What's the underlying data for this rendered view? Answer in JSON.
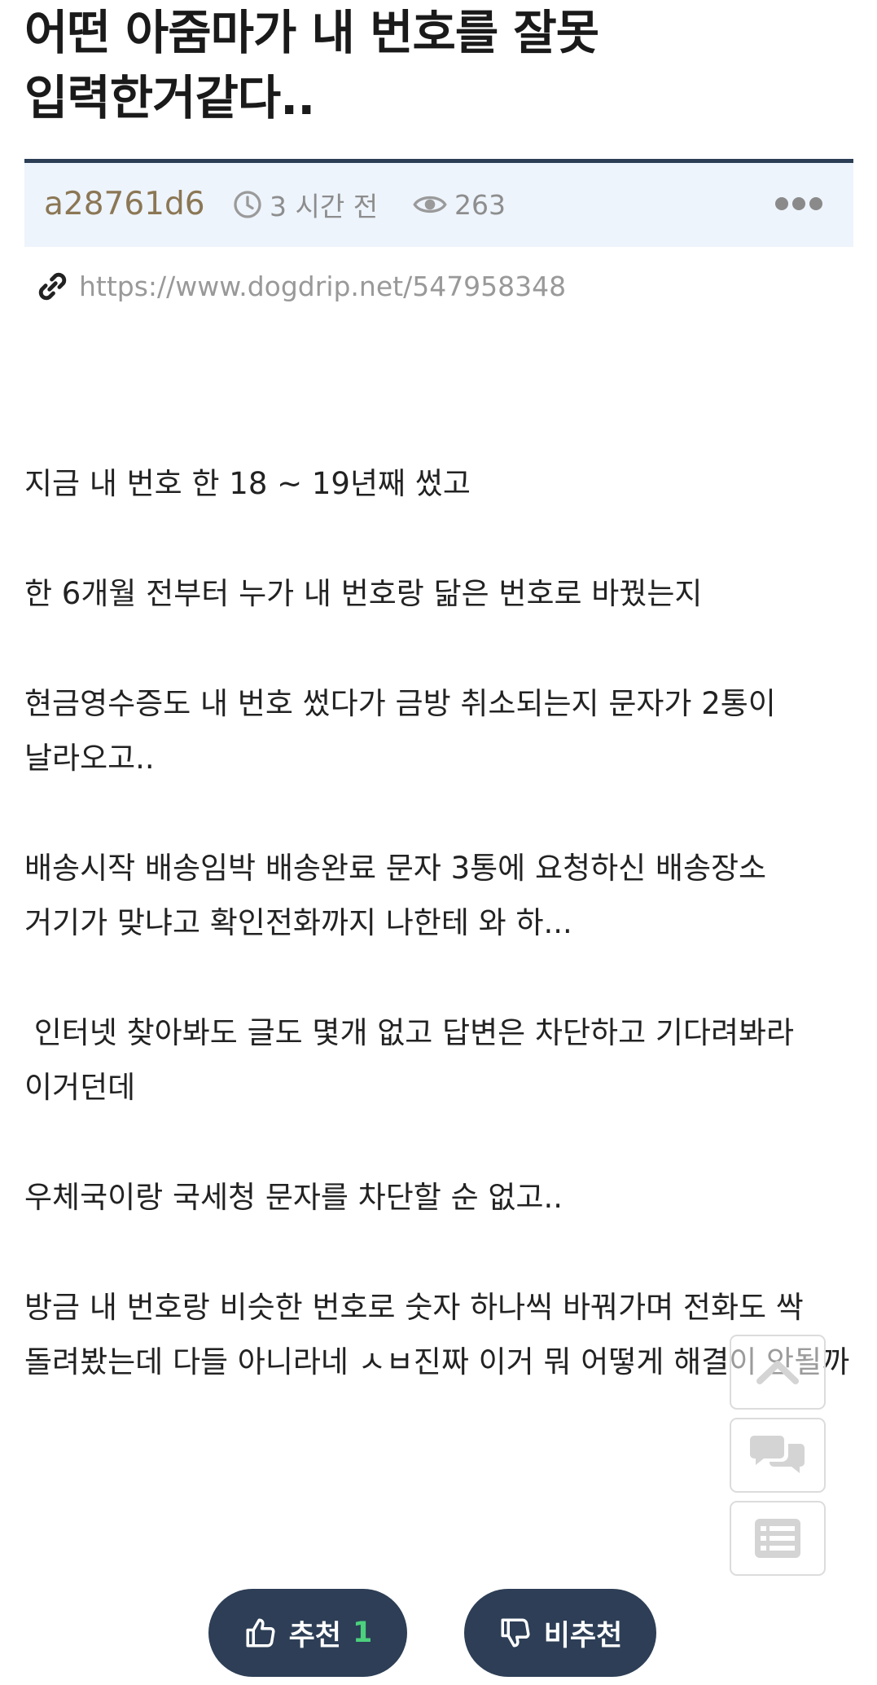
{
  "post": {
    "title": "어떤 아줌마가 내 번호를 잘못 입력한거같다..",
    "author": "a28761d6",
    "time": "3 시간 전",
    "views": "263",
    "url": "https://www.dogdrip.net/547958348",
    "paragraphs": [
      "지금 내 번호 한 18 ~ 19년째 썼고",
      "한 6개월 전부터 누가 내 번호랑 닮은 번호로 바꿨는지",
      "현금영수증도 내 번호 썼다가 금방 취소되는지 문자가 2통이 날라오고..",
      "배송시작 배송임박 배송완료 문자 3통에 요청하신 배송장소 거기가 맞냐고 확인전화까지 나한테 와 하...",
      " 인터넷 찾아봐도 글도 몇개 없고 답변은 차단하고 기다려봐라 이거던데",
      "우체국이랑 국세청 문자를 차단할 순 없고..",
      "방금 내 번호랑 비슷한 번호로 숫자 하나씩 바꿔가며 전화도 싹 돌려봤는데 다들 아니라네 ㅅㅂ진짜 이거 뭐 어떻게 해결이 안될까"
    ]
  },
  "icons": {
    "time": "clock-icon",
    "views": "eye-icon",
    "more": "more-dots-icon",
    "link": "link-icon",
    "scroll_top": "chevron-up-icon",
    "comments": "comments-icon",
    "list": "list-icon",
    "upvote": "thumbs-up-icon",
    "downvote": "thumbs-down-icon"
  },
  "votes": {
    "up_label": "추천",
    "up_count": "1",
    "down_label": "비추천"
  },
  "colors": {
    "meta_bg": "#eef4fc",
    "meta_border": "#2c3e55",
    "author": "#8b7755",
    "vote_button": "#2d3e56",
    "up_count": "#4cd07d"
  }
}
